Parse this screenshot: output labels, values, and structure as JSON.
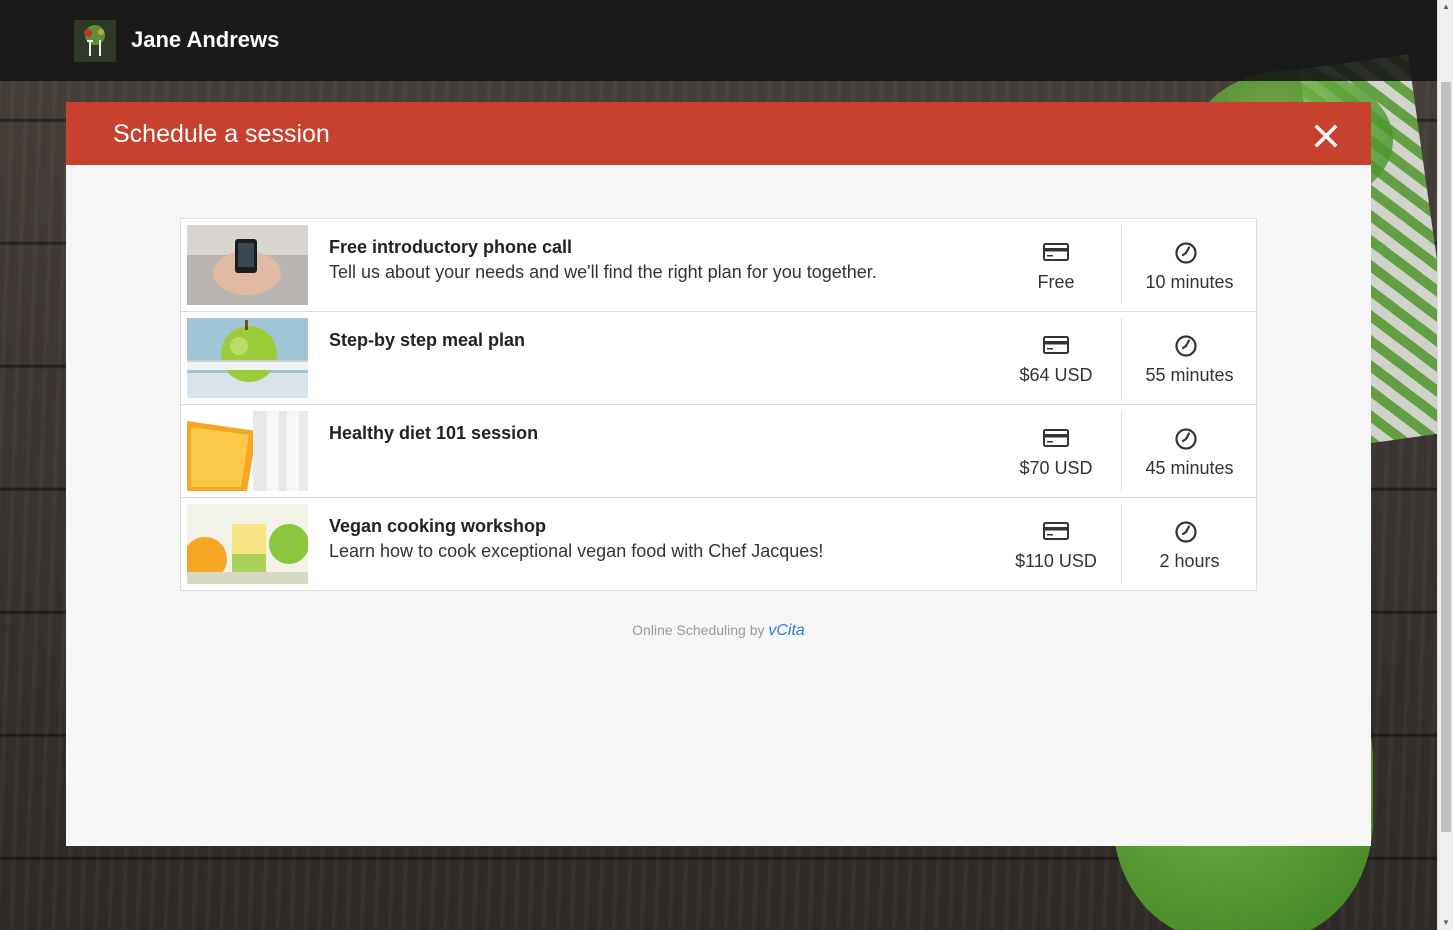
{
  "header": {
    "user_name": "Jane Andrews",
    "logo_icon": "tree-fork-logo-icon"
  },
  "modal": {
    "title": "Schedule a session",
    "close_icon": "close-icon",
    "accent_color": "#c8412e"
  },
  "services": [
    {
      "name": "Free introductory phone call",
      "description": "Tell us about your needs and we'll find the right plan for you together.",
      "price": "Free",
      "duration": "10 minutes",
      "image": "phone-in-hands-photo"
    },
    {
      "name": "Step-by step meal plan",
      "description": "",
      "price": "$64 USD",
      "duration": "55 minutes",
      "image": "apple-with-measuring-tape-photo"
    },
    {
      "name": "Healthy diet 101 session",
      "description": "",
      "price": "$70 USD",
      "duration": "45 minutes",
      "image": "orange-with-measuring-tape-photo"
    },
    {
      "name": "Vegan cooking workshop",
      "description": "Learn how to cook exceptional vegan food with Chef Jacques!",
      "price": "$110 USD",
      "duration": "2 hours",
      "image": "fruits-and-juice-photo"
    }
  ],
  "footer": {
    "powered_prefix": "Online Scheduling by",
    "powered_brand": "vCita",
    "brand_color": "#2b7bd6"
  }
}
